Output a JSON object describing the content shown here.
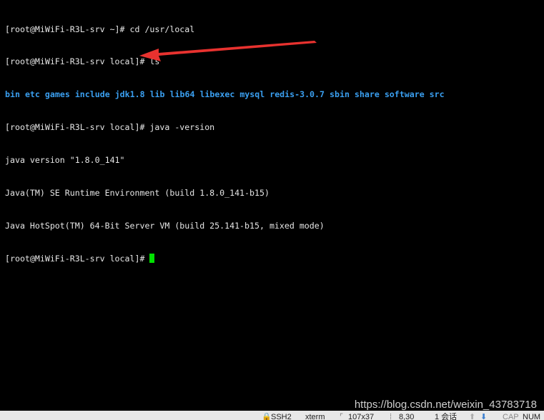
{
  "terminal": {
    "lines": [
      "[root@MiWiFi-R3L-srv ~]# cd /usr/local",
      "[root@MiWiFi-R3L-srv local]# ls",
      "[root@MiWiFi-R3L-srv local]# java -version",
      "java version \"1.8.0_141\"",
      "Java(TM) SE Runtime Environment (build 1.8.0_141-b15)",
      "Java HotSpot(TM) 64-Bit Server VM (build 25.141-b15, mixed mode)",
      "[root@MiWiFi-R3L-srv local]# "
    ],
    "ls_output": [
      "bin",
      "etc",
      "games",
      "include",
      "jdk1.8",
      "lib",
      "lib64",
      "libexec",
      "mysql",
      "redis-3.0.7",
      "sbin",
      "share",
      "software",
      "src"
    ],
    "dir_color": "#3a9ff0",
    "cursor_color": "#00e000"
  },
  "annotation": {
    "arrow_color": "#e8322f"
  },
  "watermark": "https://blog.csdn.net/weixin_43783718",
  "statusbar": {
    "protocol": "SSH2",
    "terminal_type": "xterm",
    "size": "107x37",
    "cursor_pos": "8,30",
    "sessions": "1 会话",
    "caps": "CAP",
    "num": "NUM"
  }
}
